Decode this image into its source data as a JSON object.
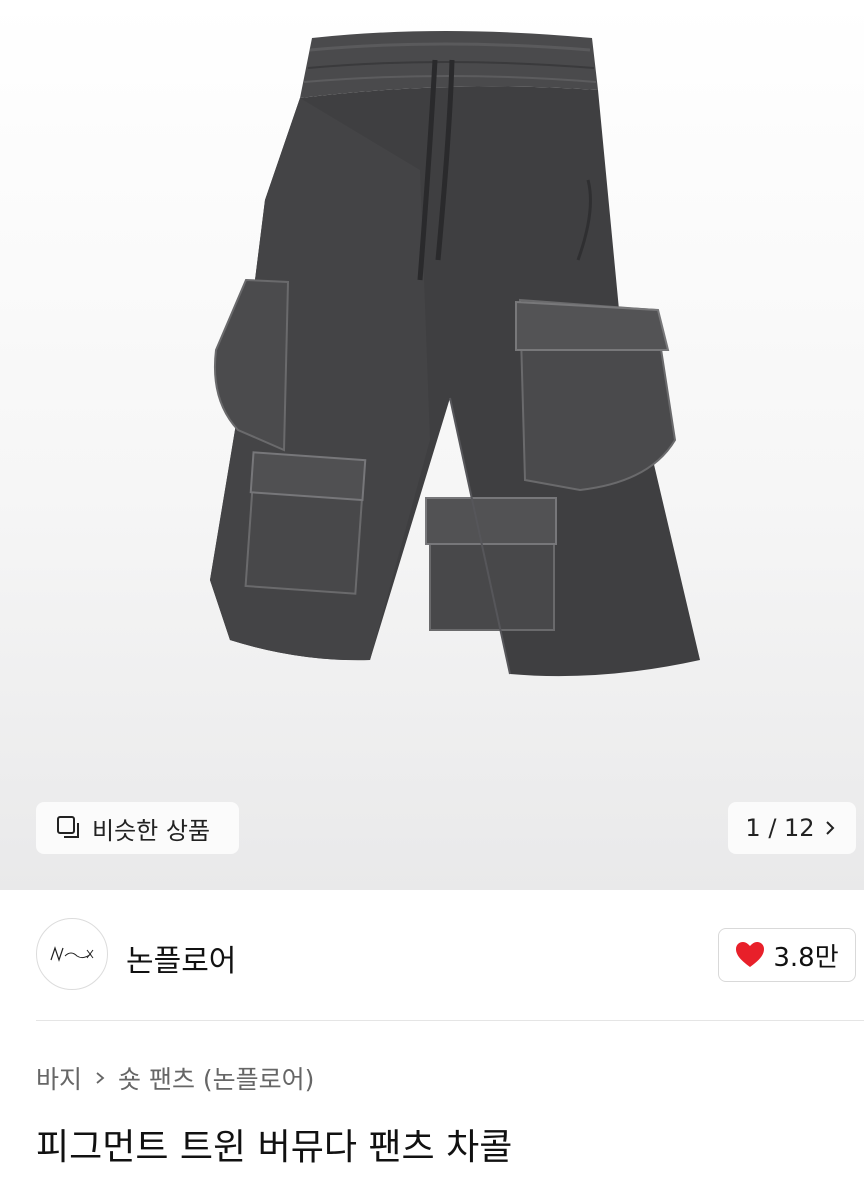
{
  "gallery": {
    "similar_label": "비슷한 상품",
    "counter": "1 / 12",
    "image_alt": "product-shorts-photo"
  },
  "brand": {
    "name": "논플로어",
    "logo_text": "Nonflo",
    "likes": "3.8만",
    "heart_color": "#e8202a"
  },
  "breadcrumb": {
    "items": [
      "바지",
      "숏 팬츠 (논플로어)"
    ]
  },
  "product": {
    "title": "피그먼트 트윈 버뮤다 팬츠 차콜"
  }
}
